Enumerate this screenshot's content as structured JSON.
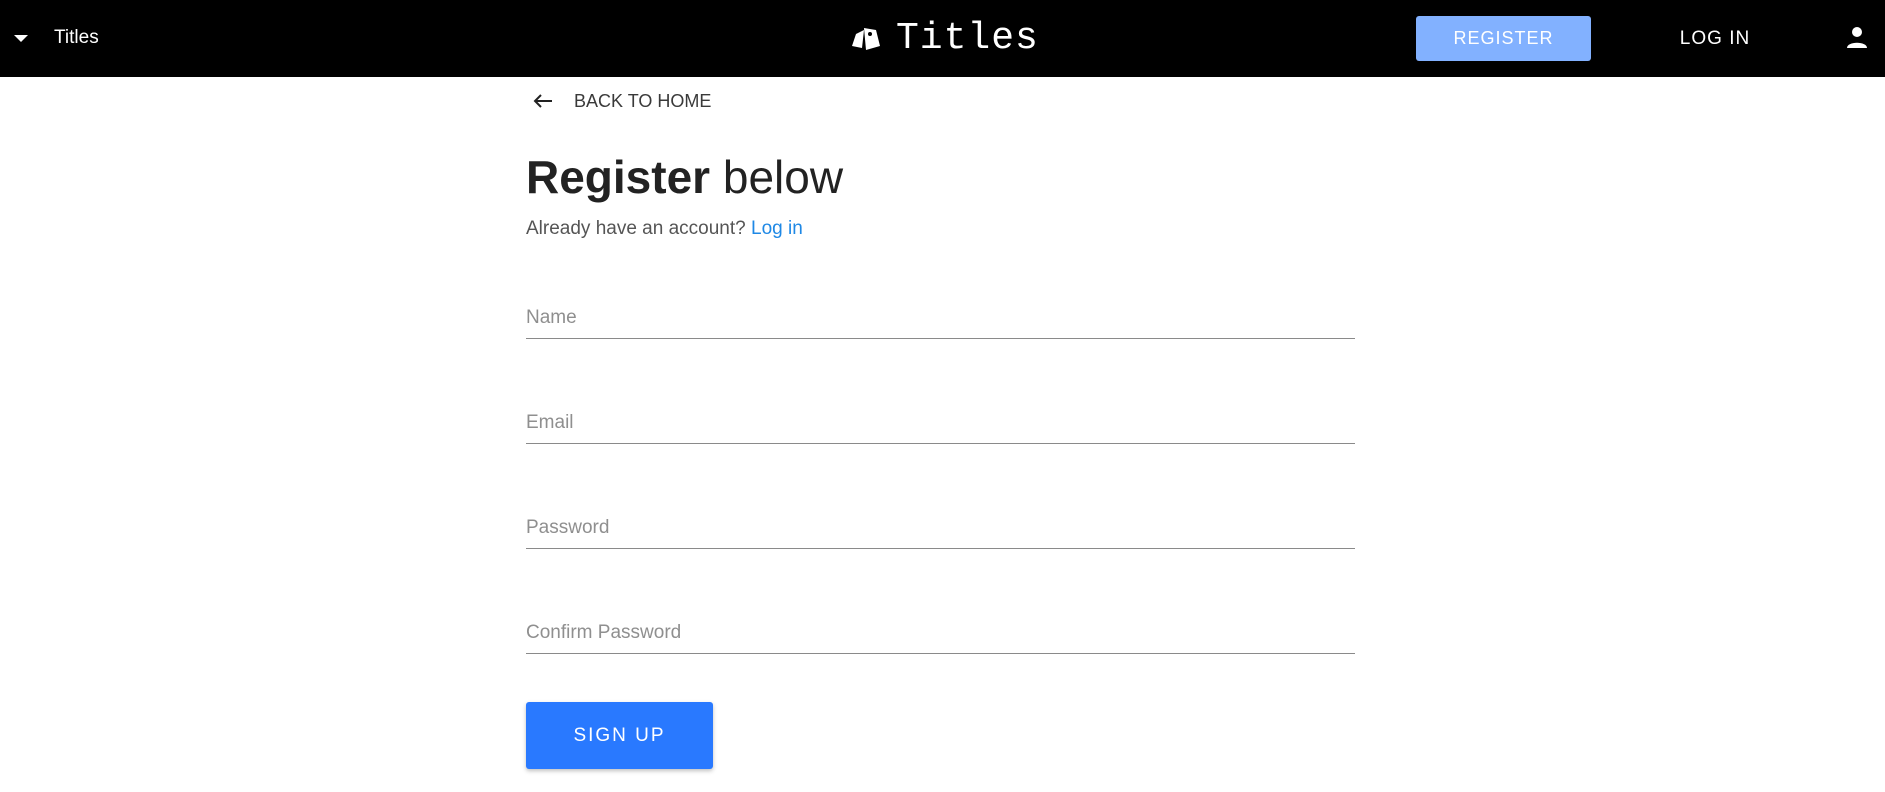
{
  "header": {
    "menu_label": "Titles",
    "brand": "Titles",
    "register_label": "REGISTER",
    "login_label": "LOG IN"
  },
  "nav": {
    "back_label": "BACK TO HOME"
  },
  "form": {
    "title_strong": "Register",
    "title_rest": " below",
    "prompt": "Already have an account?",
    "login_link": "Log in",
    "fields": [
      {
        "placeholder": "Name",
        "value": ""
      },
      {
        "placeholder": "Email",
        "value": ""
      },
      {
        "placeholder": "Password",
        "value": ""
      },
      {
        "placeholder": "Confirm Password",
        "value": ""
      }
    ],
    "submit_label": "SIGN UP"
  },
  "colors": {
    "header_bg": "#000000",
    "register_button": "#82b1ff",
    "primary_button": "#2979ff",
    "link": "#1e88e5"
  },
  "icons": {
    "menu": "caret-down-icon",
    "brand": "tag-icon",
    "account": "person-icon",
    "back": "arrow-left-icon"
  }
}
